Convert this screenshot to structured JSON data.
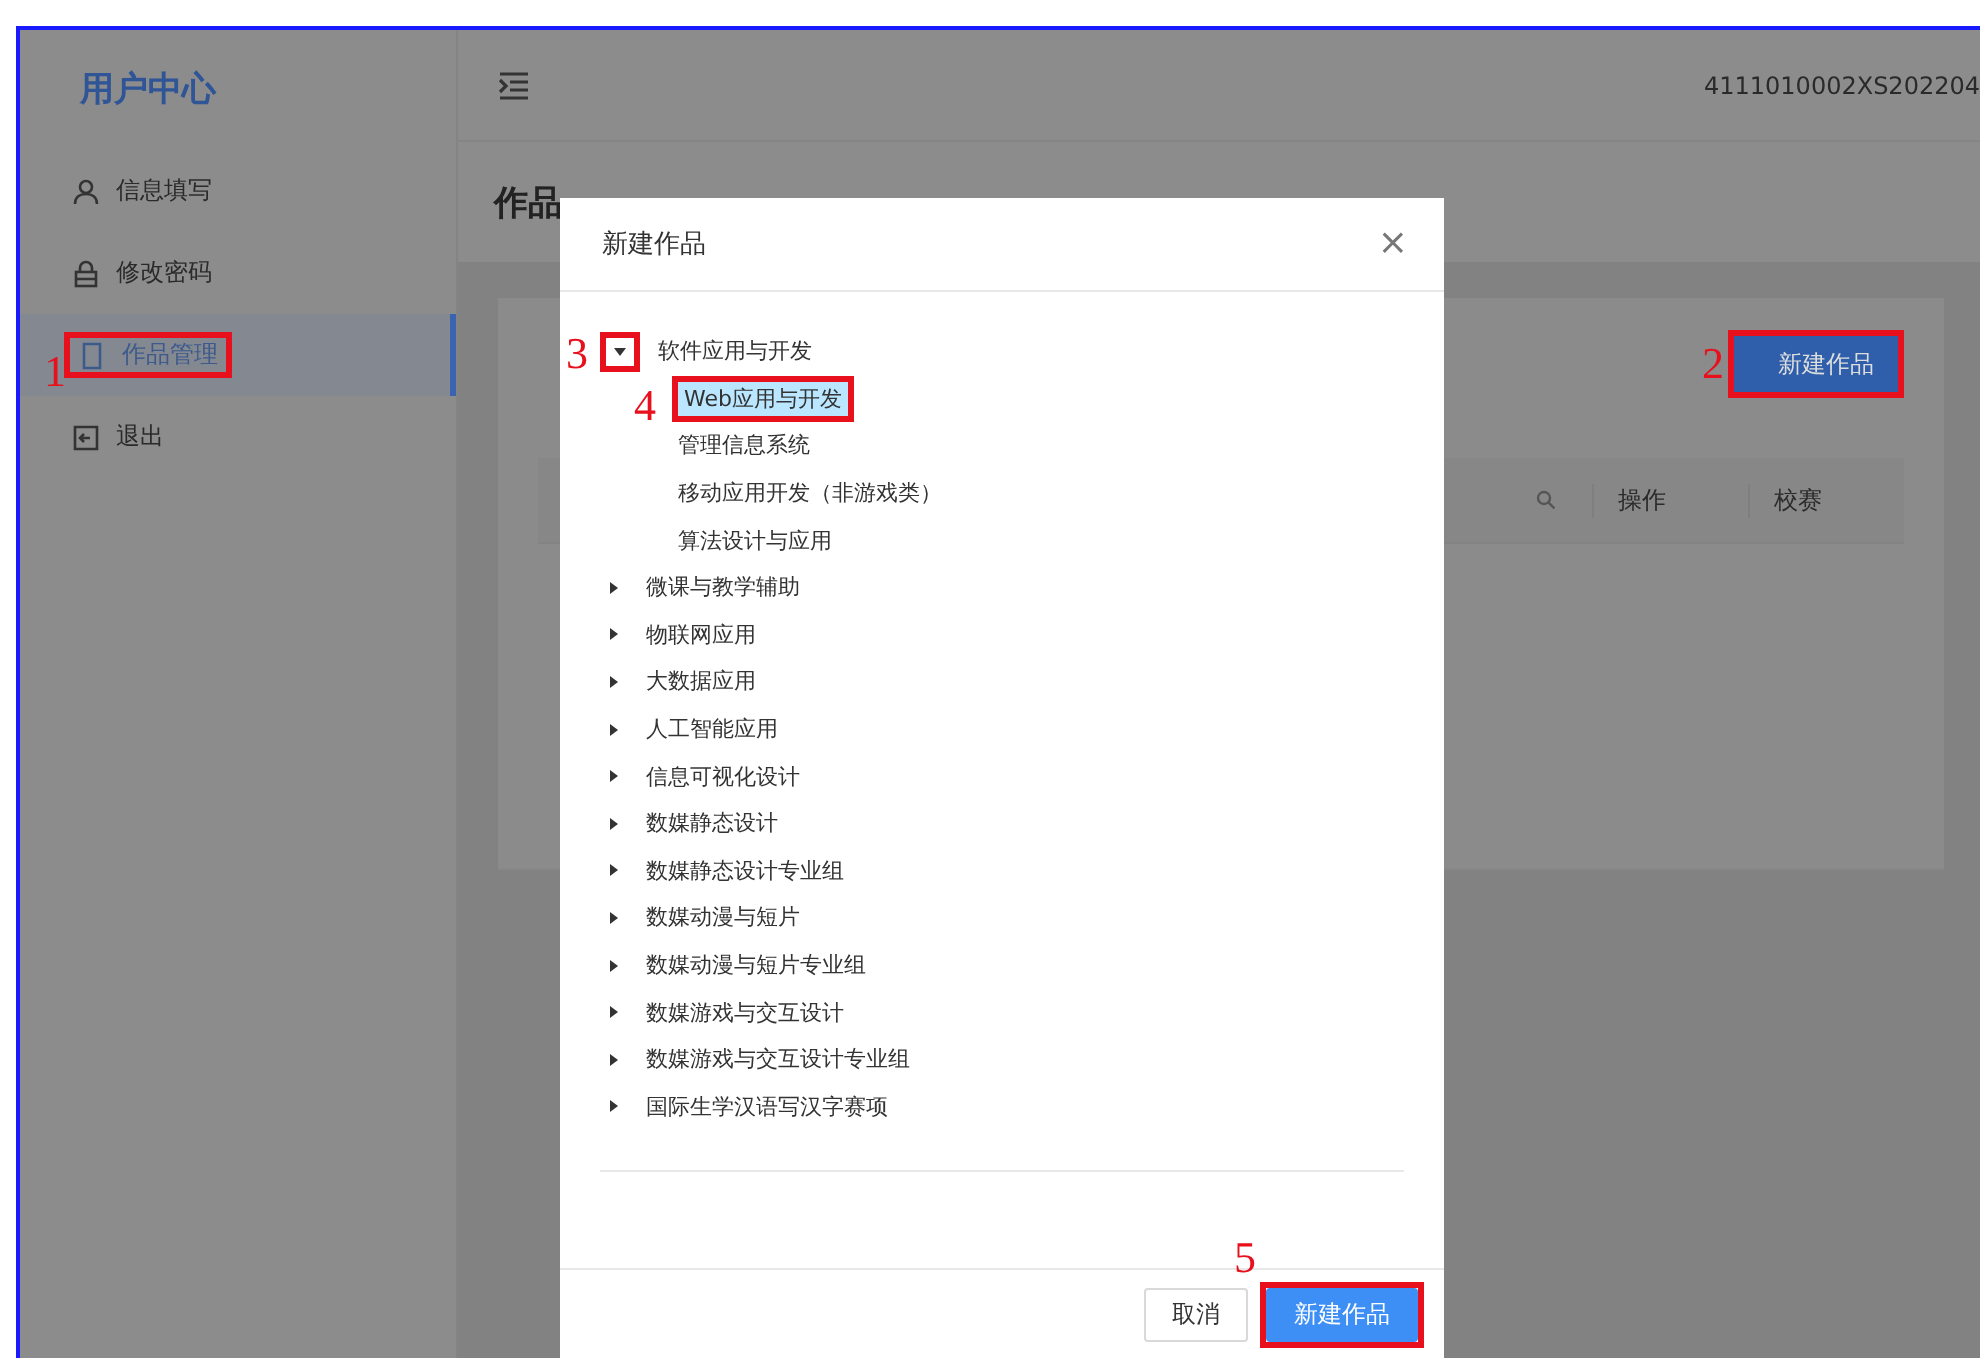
{
  "sidebar": {
    "title": "用户中心",
    "items": [
      {
        "label": "信息填写",
        "kind": "person",
        "selected": false
      },
      {
        "label": "修改密码",
        "kind": "lock",
        "selected": false
      },
      {
        "label": "作品管理",
        "kind": "document",
        "selected": true,
        "annotation": "1"
      },
      {
        "label": "退出",
        "kind": "logout",
        "selected": false
      }
    ]
  },
  "header": {
    "user_id": "4111010002XS202204"
  },
  "page_title": "作品",
  "toolbar": {
    "new_button": {
      "label": "新建作品",
      "annotation": "2"
    }
  },
  "table": {
    "columns": [
      {
        "label": "操作"
      },
      {
        "label": "校赛"
      }
    ]
  },
  "dialog": {
    "title": "新建作品",
    "close": "×",
    "tree": [
      {
        "label": "软件应用与开发",
        "expanded": true,
        "annotation": "3",
        "children": [
          {
            "label": "Web应用与开发",
            "selected": true,
            "annotation": "4"
          },
          {
            "label": "管理信息系统",
            "selected": false
          },
          {
            "label": "移动应用开发（非游戏类）",
            "selected": false
          },
          {
            "label": "算法设计与应用",
            "selected": false
          }
        ]
      },
      {
        "label": "微课与教学辅助",
        "expanded": false
      },
      {
        "label": "物联网应用",
        "expanded": false
      },
      {
        "label": "大数据应用",
        "expanded": false
      },
      {
        "label": "人工智能应用",
        "expanded": false
      },
      {
        "label": "信息可视化设计",
        "expanded": false
      },
      {
        "label": "数媒静态设计",
        "expanded": false
      },
      {
        "label": "数媒静态设计专业组",
        "expanded": false
      },
      {
        "label": "数媒动漫与短片",
        "expanded": false
      },
      {
        "label": "数媒动漫与短片专业组",
        "expanded": false
      },
      {
        "label": "数媒游戏与交互设计",
        "expanded": false
      },
      {
        "label": "数媒游戏与交互设计专业组",
        "expanded": false
      },
      {
        "label": "国际生学汉语写汉字赛项",
        "expanded": false
      }
    ],
    "buttons": [
      {
        "label": "取消",
        "kind": "default"
      },
      {
        "label": "新建作品",
        "kind": "primary",
        "annotation": "5"
      }
    ]
  }
}
